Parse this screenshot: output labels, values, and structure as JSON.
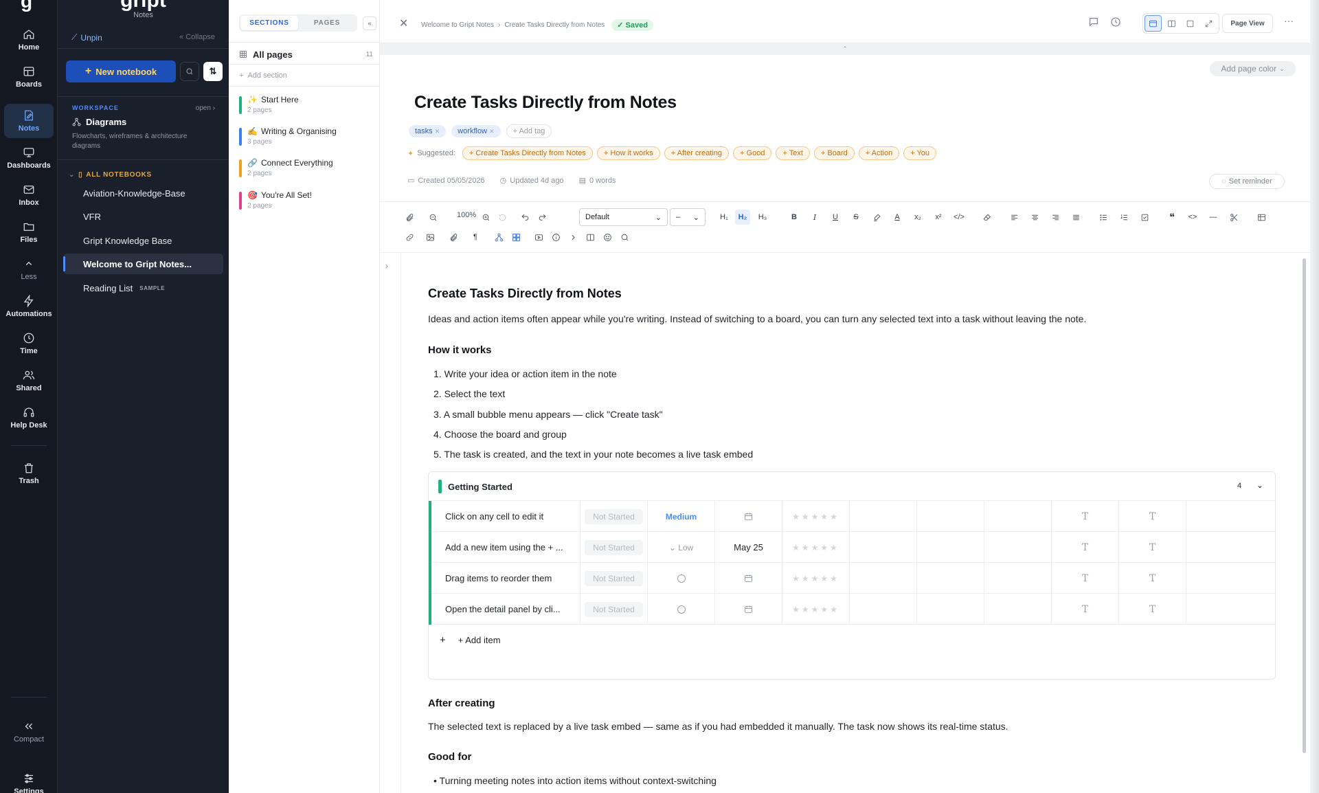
{
  "rail": {
    "logo": "g",
    "items": [
      {
        "label": "Home",
        "icon": "home-icon"
      },
      {
        "label": "Boards",
        "icon": "boards-icon"
      },
      {
        "label": "Notes",
        "icon": "notes-icon"
      },
      {
        "label": "Dashboards",
        "icon": "dashboards-icon"
      },
      {
        "label": "Inbox",
        "icon": "inbox-icon"
      },
      {
        "label": "Files",
        "icon": "folder-icon"
      },
      {
        "label": "Less",
        "icon": "chevron-up-icon"
      },
      {
        "label": "Automations",
        "icon": "lightning-icon"
      },
      {
        "label": "Time",
        "icon": "clock-icon"
      },
      {
        "label": "Shared",
        "icon": "users-icon"
      },
      {
        "label": "Help Desk",
        "icon": "headset-icon"
      },
      {
        "label": "Trash",
        "icon": "trash-icon"
      },
      {
        "label": "Compact",
        "icon": "double-chevron-left-icon"
      },
      {
        "label": "Settings",
        "icon": "sliders-icon"
      }
    ]
  },
  "notebook_panel": {
    "brand": "gript",
    "brand_sub": "Notes",
    "unpin": "Unpin",
    "collapse": "Collapse",
    "new_notebook": "New notebook",
    "workspace_label": "WORKSPACE",
    "workspace_open": "open",
    "workspace_name": "Diagrams",
    "workspace_desc": "Flowcharts, wireframes & architecture diagrams",
    "all_notebooks": "ALL NOTEBOOKS",
    "notebooks": [
      {
        "label": "Aviation-Knowledge-Base",
        "badge": ""
      },
      {
        "label": "VFR",
        "badge": ""
      },
      {
        "label": "Gript Knowledge Base",
        "badge": ""
      },
      {
        "label": "Welcome to Gript Notes...",
        "badge": ""
      },
      {
        "label": "Reading List",
        "badge": "SAMPLE"
      }
    ]
  },
  "sections_panel": {
    "tab_sections": "SECTIONS",
    "tab_pages": "PAGES",
    "all_pages": "All pages",
    "all_pages_count": "11",
    "add_section": "Add section",
    "sections": [
      {
        "emoji": "✨",
        "title": "Start Here",
        "sub": "2 pages",
        "color": "#22b07d"
      },
      {
        "emoji": "✍️",
        "title": "Writing & Organising",
        "sub": "3 pages",
        "color": "#3b7ff2"
      },
      {
        "emoji": "🔗",
        "title": "Connect Everything",
        "sub": "2 pages",
        "color": "#f0a020"
      },
      {
        "emoji": "🎯",
        "title": "You're All Set!",
        "sub": "2 pages",
        "color": "#e0408a"
      }
    ]
  },
  "topbar": {
    "crumb_1": "Welcome to Gript Notes",
    "crumb_sep": "›",
    "crumb_2": "Create Tasks Directly from Notes",
    "saved": "✓ Saved",
    "page_view": "Page View",
    "more": "···"
  },
  "page": {
    "add_page_color": "Add page color",
    "title": "Create Tasks Directly from Notes",
    "tags": [
      "tasks",
      "workflow"
    ],
    "add_tag": "+ Add tag",
    "suggested_label": "Suggested:",
    "suggested": [
      "+ Create Tasks Directly from Notes",
      "+ How it works",
      "+ After creating",
      "+ Good",
      "+ Text",
      "+ Board",
      "+ Action",
      "+ You"
    ],
    "created": "Created 05/05/2026",
    "updated": "Updated 4d ago",
    "words": "0 words",
    "set_reminder": "Set reminder"
  },
  "editor_toolbar": {
    "zoom": "100%",
    "style_select": "Default",
    "size_select": "–",
    "h1": "H₁",
    "h2": "H₂",
    "h3": "H₃"
  },
  "doc": {
    "heading": "Create Tasks Directly from Notes",
    "intro": "Ideas and action items often appear while you're writing. Instead of switching to a board, you can turn any selected text into a task without leaving the note.",
    "how_title": "How it works",
    "steps": [
      "1. Write your idea or action item in the note",
      "2. Select the text",
      "3. A small bubble menu appears — click \"Create task\"",
      "4. Choose the board and group",
      "5. The task is created, and the text in your note becomes a live task embed"
    ],
    "after_title": "After creating",
    "after_text": "The selected text is replaced by a live task embed — same as if you had embedded it manually. The task now shows its real-time status.",
    "good_title": "Good for",
    "good_items": [
      "• Turning meeting notes into action items without context-switching"
    ]
  },
  "board": {
    "group_name": "Getting Started",
    "count": "4",
    "rows": [
      {
        "name": "Click on any cell to edit it",
        "status": "Not Started",
        "priority": "Medium",
        "priority_kind": "medium",
        "date": ""
      },
      {
        "name": "Add a new item using the + ...",
        "status": "Not Started",
        "priority": "Low",
        "priority_kind": "low",
        "date": "May 25"
      },
      {
        "name": "Drag items to reorder them",
        "status": "Not Started",
        "priority": "",
        "priority_kind": "none",
        "date": ""
      },
      {
        "name": "Open the detail panel by cli...",
        "status": "Not Started",
        "priority": "",
        "priority_kind": "none",
        "date": ""
      }
    ],
    "add_item": "+ Add item",
    "stars": "★★★★★",
    "text_glyph": "T"
  }
}
